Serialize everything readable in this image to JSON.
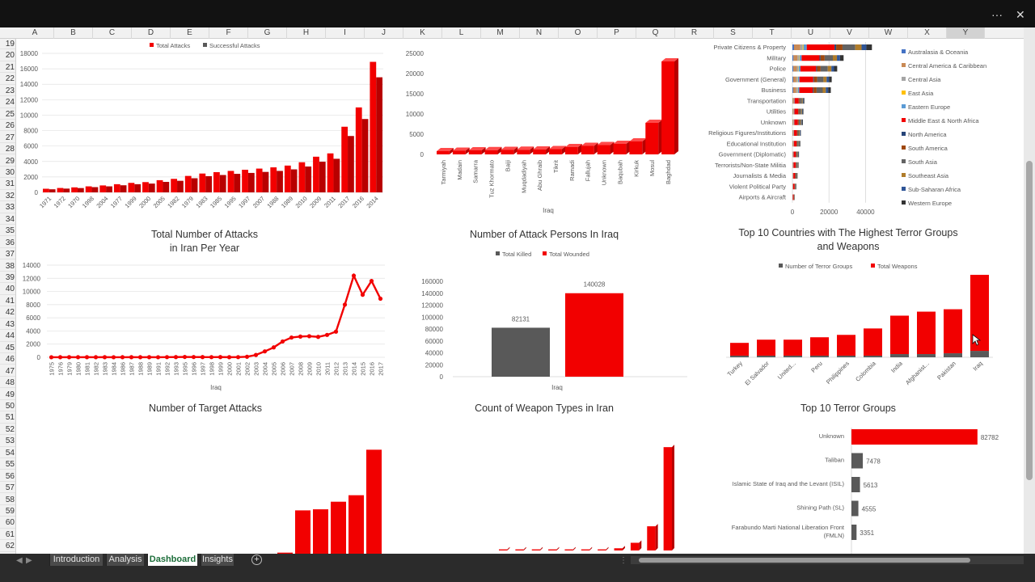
{
  "window": {
    "more_icon": "···",
    "close_icon": "✕"
  },
  "columns": [
    "A",
    "B",
    "C",
    "D",
    "E",
    "F",
    "G",
    "H",
    "I",
    "J",
    "K",
    "L",
    "M",
    "N",
    "O",
    "P",
    "Q",
    "R",
    "S",
    "T",
    "U",
    "V",
    "W",
    "X",
    "Y"
  ],
  "selected_column": "Y",
  "rows": [
    "19",
    "20",
    "21",
    "22",
    "23",
    "24",
    "25",
    "26",
    "27",
    "28",
    "29",
    "30",
    "31",
    "32",
    "33",
    "34",
    "35",
    "36",
    "37",
    "38",
    "39",
    "40",
    "41",
    "42",
    "43",
    "44",
    "45",
    "46",
    "47",
    "48",
    "49",
    "50",
    "51",
    "52",
    "53",
    "54",
    "55",
    "56",
    "57",
    "58",
    "59",
    "60",
    "61",
    "62"
  ],
  "tabs": {
    "items": [
      {
        "label": "Introduction",
        "active": false
      },
      {
        "label": "Analysis",
        "active": false
      },
      {
        "label": "Dashboard",
        "active": true
      },
      {
        "label": "Insights",
        "active": false
      }
    ],
    "add_icon": "+",
    "nav_prev": "◀",
    "nav_next": "▶",
    "more": "⋮"
  },
  "colors": {
    "red": "#f20000",
    "darkred": "#b80000",
    "gray": "#595959",
    "grid": "#e2e2e2",
    "axis": "#595959"
  },
  "chart_data": [
    {
      "id": "attacks-by-year",
      "type": "bar",
      "title": "",
      "legend": [
        "Total Attacks",
        "Successful Attacks"
      ],
      "categories": [
        "1971",
        "1972",
        "1970",
        "1998",
        "2004",
        "1977",
        "1999",
        "2000",
        "2005",
        "1982",
        "1979",
        "1983",
        "1985",
        "1995",
        "1997",
        "2007",
        "1988",
        "1989",
        "2010",
        "2009",
        "2011",
        "2017",
        "2016",
        "2014"
      ],
      "series": [
        {
          "name": "Total Attacks",
          "values": [
            470,
            570,
            650,
            780,
            900,
            1060,
            1230,
            1330,
            1580,
            1750,
            2130,
            2440,
            2620,
            2780,
            2930,
            3080,
            3240,
            3470,
            3900,
            4620,
            5050,
            8500,
            11000,
            16900
          ]
        },
        {
          "name": "Successful Attacks",
          "values": [
            400,
            490,
            560,
            680,
            780,
            920,
            1060,
            1140,
            1360,
            1500,
            1830,
            2100,
            2250,
            2400,
            2520,
            2650,
            2780,
            2980,
            3350,
            3970,
            4350,
            7300,
            9500,
            14900
          ]
        }
      ],
      "yticks": [
        "0",
        "2000",
        "4000",
        "6000",
        "8000",
        "10000",
        "12000",
        "14000",
        "16000",
        "18000"
      ],
      "ylim": [
        0,
        18000
      ]
    },
    {
      "id": "attack-persons-iraq",
      "type": "bar",
      "title": "",
      "xlabel": "Iraq",
      "categories": [
        "Tarmiyah",
        "Madain",
        "Samarra",
        "Tuz Khormato",
        "Baiji",
        "Muqdadiyah",
        "Abu Ghraib",
        "Tikrit",
        "Ramadi",
        "Fallujah",
        "Unknown",
        "Baqubah",
        "Kirkuk",
        "Mosul",
        "Baghdad"
      ],
      "values": [
        800,
        900,
        1000,
        1050,
        1100,
        1150,
        1200,
        1300,
        1800,
        2100,
        2300,
        2600,
        3200,
        7800,
        23000
      ],
      "yticks": [
        "0",
        "5000",
        "10000",
        "15000",
        "20000",
        "25000"
      ],
      "ylim": [
        0,
        25000
      ]
    },
    {
      "id": "target-by-region",
      "type": "bar",
      "title": "",
      "categories": [
        "Private Citizens & Property",
        "Military",
        "Police",
        "Government (General)",
        "Business",
        "Transportation",
        "Utilities",
        "Unknown",
        "Religious Figures/Institutions",
        "Educational Institution",
        "Government (Diplomatic)",
        "Terrorists/Non-State Militia",
        "Journalists & Media",
        "Violent Political Party",
        "Airports & Aircraft"
      ],
      "values": [
        43500,
        28000,
        24500,
        21500,
        21000,
        6500,
        6000,
        5700,
        4600,
        4300,
        3600,
        3400,
        2800,
        2200,
        1300
      ],
      "regions": [
        "Australasia & Oceania",
        "Central America & Caribbean",
        "Central Asia",
        "East Asia",
        "Eastern Europe",
        "Middle East & North Africa",
        "North America",
        "South America",
        "South Asia",
        "Southeast Asia",
        "Sub-Saharan Africa",
        "Western Europe"
      ],
      "region_colors": [
        "#4472c4",
        "#c98a55",
        "#a5a5a5",
        "#ffc000",
        "#5b9bd5",
        "#f20000",
        "#264478",
        "#9e480e",
        "#636363",
        "#b07c2a",
        "#2f5597",
        "#333333"
      ],
      "xticks": [
        "0",
        "20000",
        "40000"
      ],
      "xlim": [
        0,
        50000
      ]
    },
    {
      "id": "iran-per-year",
      "type": "line",
      "title": "Total Number of Attacks\nin Iran Per Year",
      "xlabel": "Iraq",
      "categories": [
        "1975",
        "1976",
        "1979",
        "1980",
        "1981",
        "1982",
        "1983",
        "1984",
        "1986",
        "1987",
        "1988",
        "1989",
        "1991",
        "1992",
        "1993",
        "1995",
        "1996",
        "1997",
        "1998",
        "1999",
        "2000",
        "2001",
        "2002",
        "2003",
        "2004",
        "2005",
        "2006",
        "2007",
        "2008",
        "2009",
        "2010",
        "2011",
        "2012",
        "2013",
        "2014",
        "2015",
        "2016",
        "2017"
      ],
      "values": [
        10,
        12,
        15,
        12,
        14,
        12,
        15,
        10,
        12,
        14,
        12,
        15,
        10,
        20,
        30,
        50,
        40,
        30,
        25,
        30,
        15,
        20,
        80,
        350,
        900,
        1500,
        2400,
        3000,
        3150,
        3200,
        3100,
        3400,
        3900,
        8000,
        12400,
        9500,
        11600,
        8900
      ],
      "yticks": [
        "0",
        "2000",
        "4000",
        "6000",
        "8000",
        "10000",
        "12000",
        "14000"
      ],
      "ylim": [
        0,
        14000
      ]
    },
    {
      "id": "attack-persons-killed-wounded",
      "type": "bar",
      "title": "Number of Attack Persons  In Iraq",
      "legend": [
        "Total Killed",
        "Total Wounded"
      ],
      "xlabel": "Iraq",
      "values": [
        82131,
        140028
      ],
      "value_labels": [
        "82131",
        "140028"
      ],
      "yticks": [
        "0",
        "20000",
        "40000",
        "60000",
        "80000",
        "100000",
        "120000",
        "140000",
        "160000"
      ],
      "ylim": [
        0,
        160000
      ]
    },
    {
      "id": "top10-countries",
      "type": "bar",
      "title": "Top 10 Countries with The Highest Terror Groups\nand Weapons",
      "legend": [
        "Number of Terror Groups",
        "Total Weapons"
      ],
      "categories": [
        "Turkey",
        "El Salvador",
        "United...",
        "Peru",
        "Philippines",
        "Colombia",
        "India",
        "Afghanist...",
        "Pakistan",
        "Iraq"
      ],
      "series": [
        {
          "name": "Number of Terror Groups",
          "values": [
            2,
            2,
            2,
            2,
            2,
            2,
            4,
            4,
            5,
            8
          ]
        },
        {
          "name": "Total Weapons",
          "values": [
            16,
            20,
            20,
            23,
            26,
            34,
            48,
            53,
            55,
            95
          ]
        }
      ],
      "ylim": [
        0,
        105
      ]
    },
    {
      "id": "target-attacks",
      "type": "bar",
      "title": "Number of Target Attacks",
      "values": [
        0,
        0,
        0,
        0,
        0,
        0,
        0,
        1,
        40,
        41,
        48,
        54,
        96
      ],
      "ylim": [
        0,
        100
      ]
    },
    {
      "id": "weapon-types-iran",
      "type": "bar",
      "title": "Count of Weapon Types in Iran",
      "values": [
        1,
        1,
        1,
        1,
        1,
        1,
        1,
        2,
        7,
        22,
        94
      ],
      "ylim": [
        0,
        100
      ]
    },
    {
      "id": "top10-terror-groups",
      "type": "bar",
      "title": "Top 10 Terror Groups",
      "categories": [
        "Unknown",
        "Taliban",
        "Islamic State of Iraq and the Levant (ISIL)",
        "Shining Path (SL)",
        "Farabundo Marti National Liberation Front\n(FMLN)"
      ],
      "values": [
        82782,
        7478,
        5613,
        4555,
        3351
      ],
      "value_labels": [
        "82782",
        "7478",
        "5613",
        "4555",
        "3351"
      ],
      "xlim": [
        0,
        85000
      ]
    }
  ]
}
